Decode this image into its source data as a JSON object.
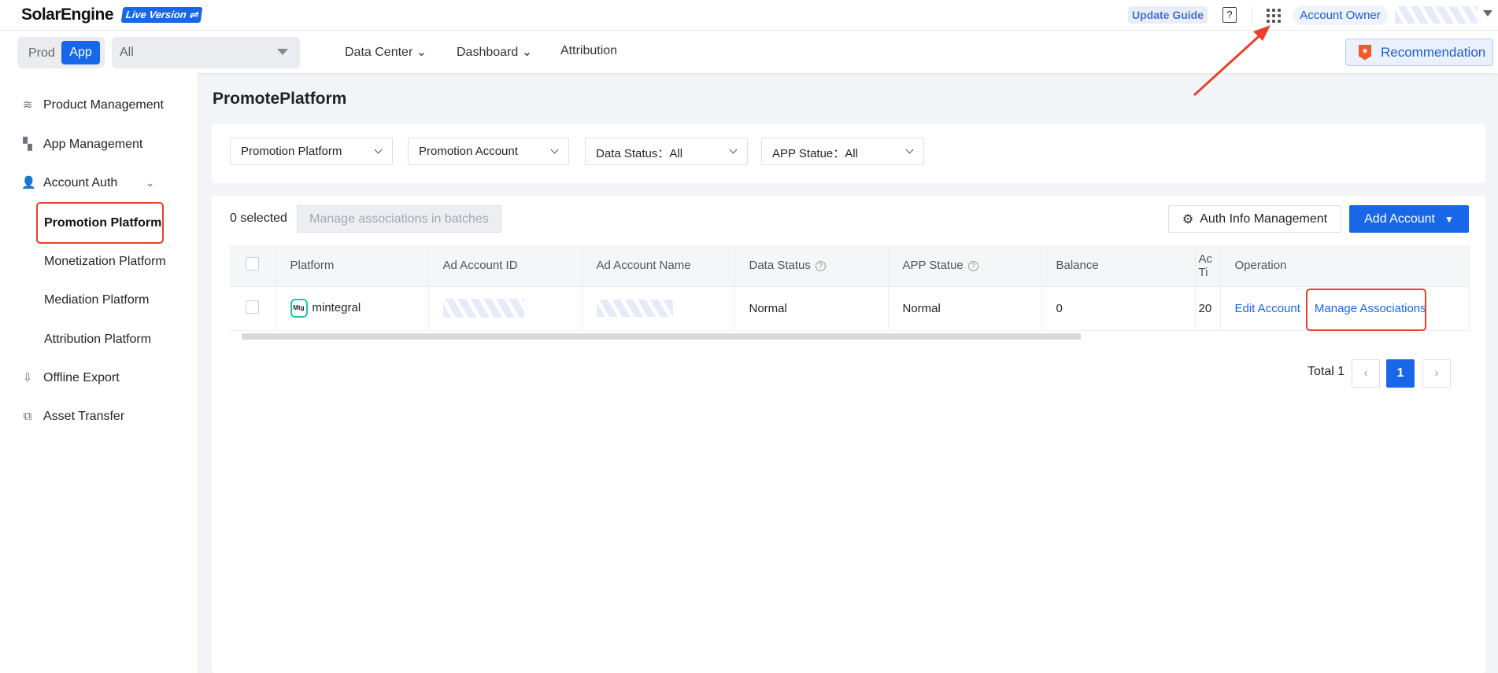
{
  "topbar": {
    "logo": "SolarEngine",
    "live_badge": "Live Version ⇌",
    "update_guide": "Update Guide",
    "help_icon": "?",
    "account_owner": "Account Owner"
  },
  "subbar": {
    "prod": "Prod",
    "app": "App",
    "app_select": "All",
    "nav": [
      "Data Center",
      "Dashboard",
      "Attribution"
    ],
    "recommendation": "Recommendation",
    "recommendation_icon": "★"
  },
  "sidebar": {
    "items": [
      {
        "label": "Product Management",
        "icon": "layers-icon"
      },
      {
        "label": "App Management",
        "icon": "grid-icon"
      },
      {
        "label": "Account Auth",
        "icon": "user-check-icon"
      },
      {
        "label": "Offline Export",
        "icon": "export-icon"
      },
      {
        "label": "Asset Transfer",
        "icon": "transfer-icon"
      }
    ],
    "sub": [
      "Promotion Platform",
      "Monetization Platform",
      "Mediation Platform",
      "Attribution Platform"
    ]
  },
  "page": {
    "title": "PromotePlatform",
    "filters": [
      "Promotion Platform",
      "Promotion Account",
      "Data Status：All",
      "APP Statue：All"
    ],
    "selected": "0 selected",
    "batch_btn": "Manage associations in batches",
    "auth_btn": "Auth Info Management",
    "add_btn": "Add Account",
    "columns": [
      "Platform",
      "Ad Account ID",
      "Ad Account Name",
      "Data Status",
      "APP Statue",
      "Balance",
      "Ac Ti",
      "Operation"
    ],
    "rows": [
      {
        "platform": "mintegral",
        "platform_logo": "Mtg",
        "data_status": "Normal",
        "app_statue": "Normal",
        "balance": "0",
        "time": "20",
        "edit": "Edit Account",
        "manage": "Manage Associations"
      }
    ],
    "total": "Total 1",
    "page": "1",
    "prev": "‹",
    "next": "›"
  },
  "colors": {
    "accent": "#1867e8",
    "highlight": "#e8402a"
  }
}
